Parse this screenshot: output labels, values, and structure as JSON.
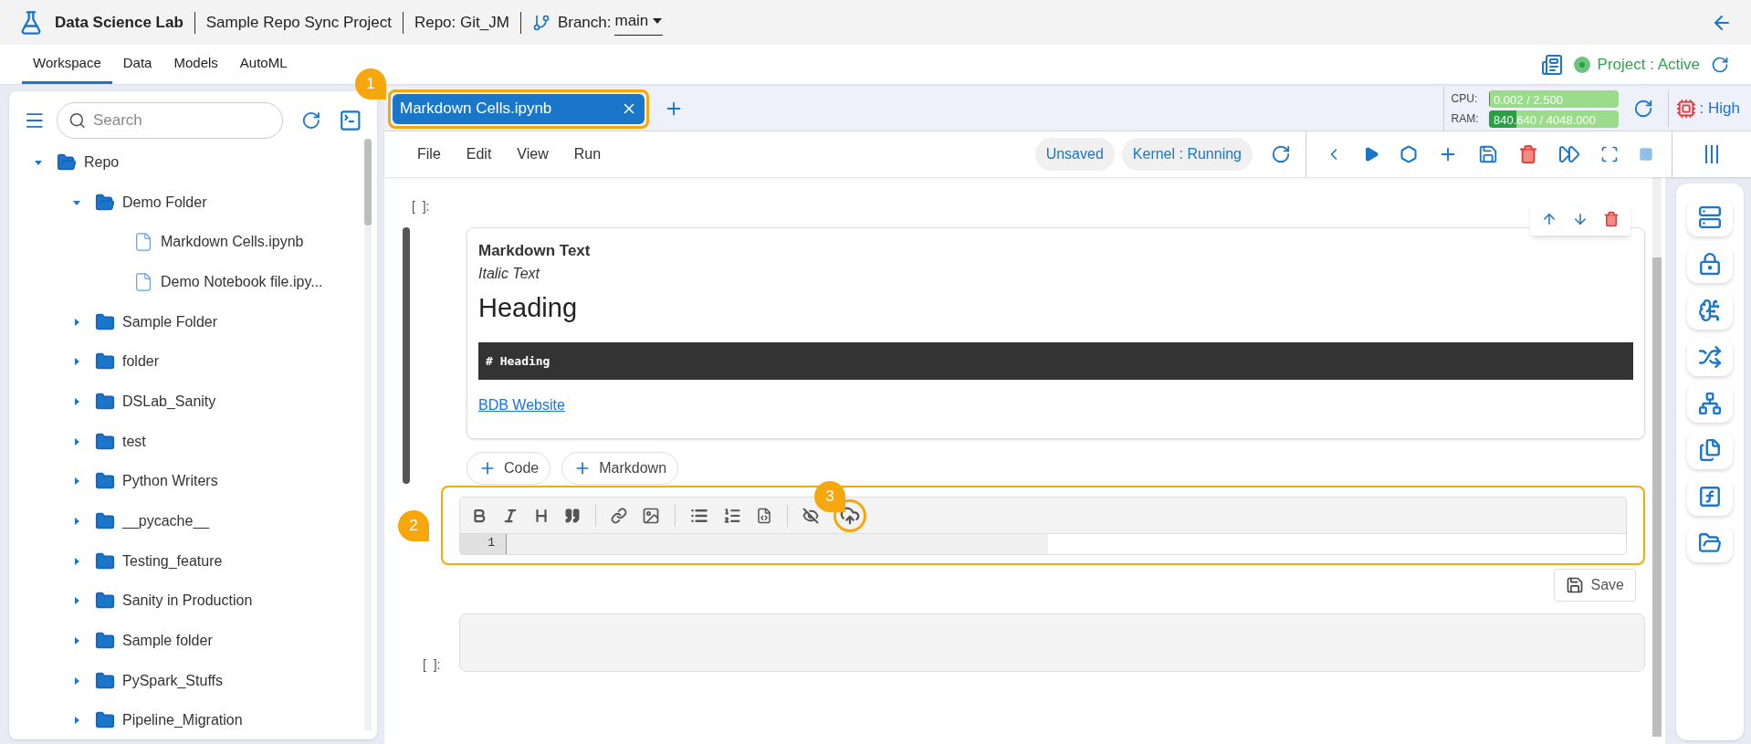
{
  "header": {
    "app_title": "Data Science Lab",
    "project": "Sample Repo Sync Project",
    "repo": "Repo: Git_JM",
    "branch_label": "Branch:",
    "branch_value": "main"
  },
  "nav_tabs": [
    {
      "label": "Workspace",
      "selected": true
    },
    {
      "label": "Data",
      "selected": false
    },
    {
      "label": "Models",
      "selected": false
    },
    {
      "label": "AutoML",
      "selected": false
    }
  ],
  "project_status": {
    "label": "Project : Active",
    "active": true
  },
  "sidebar": {
    "search_placeholder": "Search",
    "tree": [
      {
        "name": "Repo",
        "kind": "folder",
        "expanded": true,
        "children": [
          {
            "name": "Demo Folder",
            "kind": "folder",
            "expanded": true,
            "children": [
              {
                "name": "Markdown Cells.ipynb",
                "kind": "file"
              },
              {
                "name": "Demo Notebook file.ipy...",
                "kind": "file"
              }
            ]
          },
          {
            "name": "Sample Folder",
            "kind": "folder",
            "expanded": false
          },
          {
            "name": "folder",
            "kind": "folder",
            "expanded": false
          },
          {
            "name": "DSLab_Sanity",
            "kind": "folder",
            "expanded": false
          },
          {
            "name": "test",
            "kind": "folder",
            "expanded": false
          },
          {
            "name": "Python Writers",
            "kind": "folder",
            "expanded": false
          },
          {
            "name": "__pycache__",
            "kind": "folder",
            "expanded": false
          },
          {
            "name": "Testing_feature",
            "kind": "folder",
            "expanded": false
          },
          {
            "name": "Sanity in Production",
            "kind": "folder",
            "expanded": false
          },
          {
            "name": "Sample folder",
            "kind": "folder",
            "expanded": false
          },
          {
            "name": "PySpark_Stuffs",
            "kind": "folder",
            "expanded": false
          },
          {
            "name": "Pipeline_Migration",
            "kind": "folder",
            "expanded": false
          }
        ]
      }
    ]
  },
  "notebook_tabs": [
    {
      "title": "Markdown Cells.ipynb",
      "selected": true
    }
  ],
  "resources": [
    {
      "label": "CPU:",
      "reading": "0.002 / 2.500",
      "level": 0.001
    },
    {
      "label": "RAM:",
      "reading": "840.640 / 4048.000",
      "level": 0.21
    }
  ],
  "priority": ": High",
  "menu": [
    "File",
    "Edit",
    "View",
    "Run"
  ],
  "status_pills": [
    "Unsaved",
    "Kernel : Running"
  ],
  "cells": [
    {
      "prompt": "[  ]:",
      "bold_text": "Markdown Text",
      "italic_text": "Italic Text",
      "heading": "Heading",
      "code": "# Heading",
      "link": "BDB Website"
    }
  ],
  "add_buttons": [
    "Code",
    "Markdown"
  ],
  "editor": {
    "line_number": "1"
  },
  "save_button": "Save",
  "last_cell_prompt": "[  ]:",
  "callouts": [
    "1",
    "2",
    "3"
  ]
}
